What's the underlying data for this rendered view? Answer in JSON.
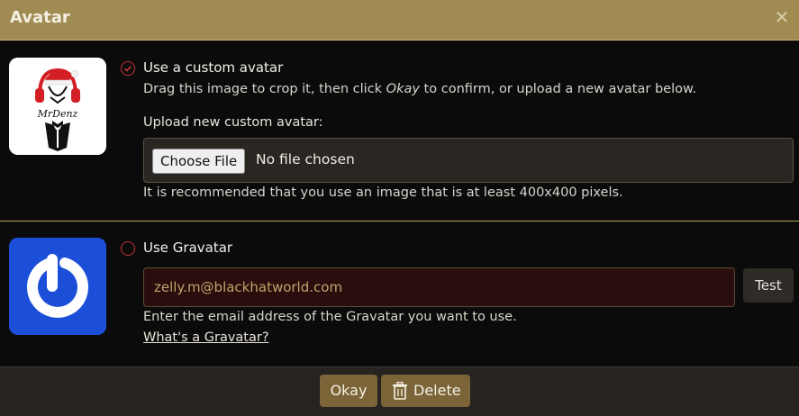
{
  "dialog": {
    "title": "Avatar",
    "close_glyph": "✕"
  },
  "custom": {
    "option_label": "Use a custom avatar",
    "hint_before": "Drag this image to crop it, then click ",
    "hint_em": "Okay",
    "hint_after": " to confirm, or upload a new avatar below.",
    "upload_label": "Upload new custom avatar:",
    "file_button": "Choose File",
    "file_status": "No file chosen",
    "recommendation": "It is recommended that you use an image that is at least 400x400 pixels.",
    "avatar_text": "MrDenz",
    "selected": true
  },
  "gravatar": {
    "option_label": "Use Gravatar",
    "email_value": "zelly.m@blackhatworld.com",
    "test_label": "Test",
    "hint": "Enter the email address of the Gravatar you want to use.",
    "link": "What's a Gravatar?",
    "selected": false
  },
  "footer": {
    "okay_label": "Okay",
    "delete_label": "Delete"
  },
  "colors": {
    "title_bar": "#a08c53",
    "accent_radio": "#c8343a",
    "button": "#7b6438",
    "gravatar_bg": "#1b4fd8"
  },
  "icons": {
    "close": "close-icon",
    "checked": "check-circle-icon",
    "trash": "trash-icon"
  }
}
